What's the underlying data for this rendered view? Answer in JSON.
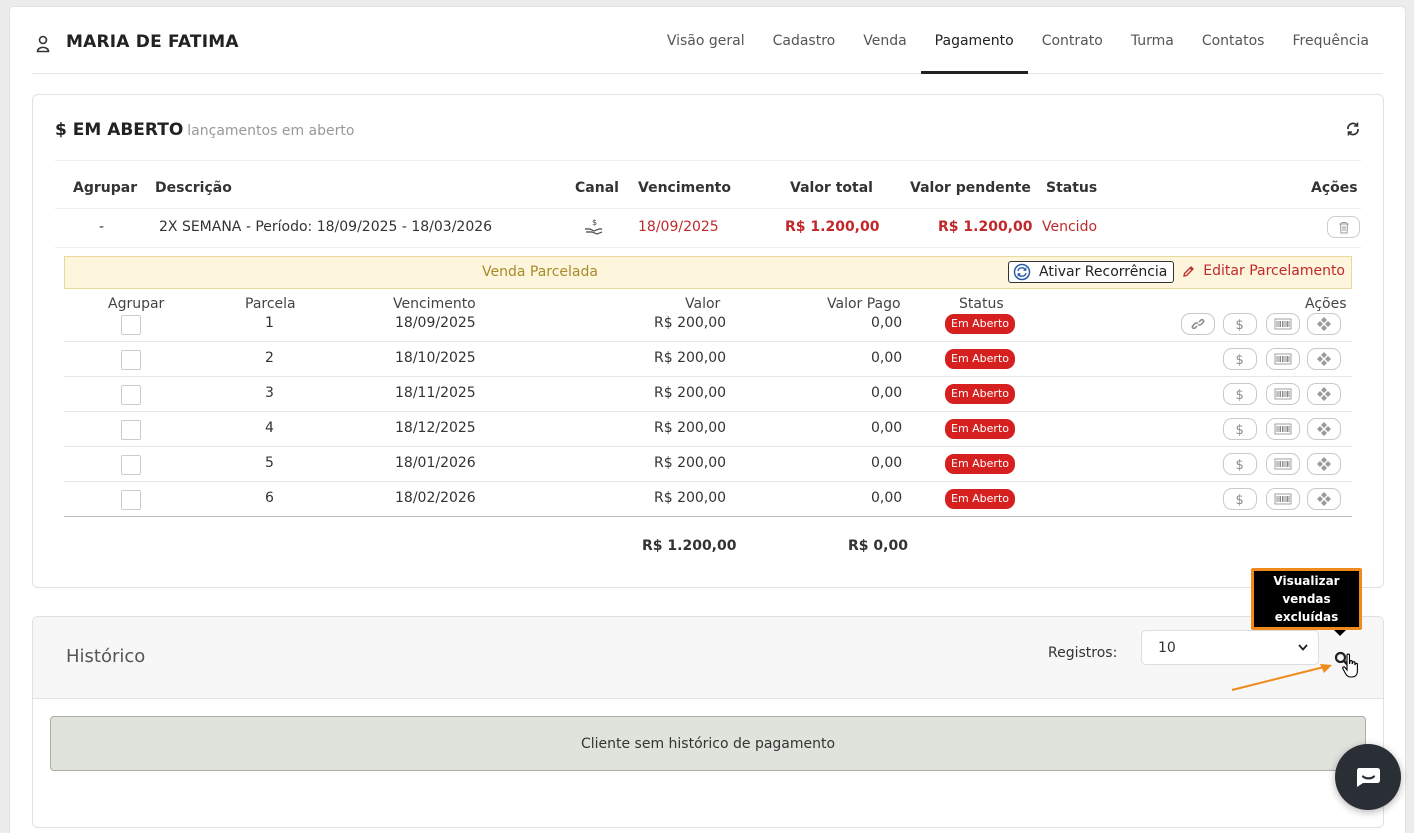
{
  "client": {
    "name": "MARIA DE FATIMA"
  },
  "tabs": [
    {
      "label": "Visão geral"
    },
    {
      "label": "Cadastro"
    },
    {
      "label": "Venda"
    },
    {
      "label": "Pagamento",
      "active": true
    },
    {
      "label": "Contrato"
    },
    {
      "label": "Turma"
    },
    {
      "label": "Contatos"
    },
    {
      "label": "Frequência"
    }
  ],
  "open": {
    "title": "$ EM ABERTO",
    "subtitle": "lançamentos em aberto",
    "columns": {
      "agrupar": "Agrupar",
      "descricao": "Descrição",
      "canal": "Canal",
      "vencimento": "Vencimento",
      "valor_total": "Valor total",
      "valor_pendente": "Valor pendente",
      "status": "Status",
      "acoes": "Ações"
    },
    "row": {
      "agrupar": "-",
      "descricao": "2X SEMANA - Período: 18/09/2025 - 18/03/2026",
      "canal_icon": "hand-money-icon",
      "vencimento": "18/09/2025",
      "valor_total": "R$ 1.200,00",
      "valor_pendente": "R$ 1.200,00",
      "status": "Vencido"
    },
    "banner": {
      "title": "Venda Parcelada",
      "recurrence_label": "Ativar Recorrência",
      "edit_label": "Editar Parcelamento"
    },
    "installments": {
      "columns": {
        "agrupar": "Agrupar",
        "parcela": "Parcela",
        "vencimento": "Vencimento",
        "valor": "Valor",
        "valor_pago": "Valor Pago",
        "status": "Status",
        "acoes": "Ações"
      },
      "rows": [
        {
          "parcela": "1",
          "vencimento": "18/09/2025",
          "valor": "R$ 200,00",
          "valor_pago": "0,00",
          "status": "Em Aberto"
        },
        {
          "parcela": "2",
          "vencimento": "18/10/2025",
          "valor": "R$ 200,00",
          "valor_pago": "0,00",
          "status": "Em Aberto"
        },
        {
          "parcela": "3",
          "vencimento": "18/11/2025",
          "valor": "R$ 200,00",
          "valor_pago": "0,00",
          "status": "Em Aberto"
        },
        {
          "parcela": "4",
          "vencimento": "18/12/2025",
          "valor": "R$ 200,00",
          "valor_pago": "0,00",
          "status": "Em Aberto"
        },
        {
          "parcela": "5",
          "vencimento": "18/01/2026",
          "valor": "R$ 200,00",
          "valor_pago": "0,00",
          "status": "Em Aberto"
        },
        {
          "parcela": "6",
          "vencimento": "18/02/2026",
          "valor": "R$ 200,00",
          "valor_pago": "0,00",
          "status": "Em Aberto"
        }
      ],
      "totals": {
        "valor": "R$ 1.200,00",
        "valor_pago": "R$ 0,00"
      }
    }
  },
  "history": {
    "title": "Histórico",
    "registros_label": "Registros:",
    "registros_value": "10",
    "empty_message": "Cliente sem histórico de pagamento"
  },
  "tooltip": {
    "text": "Visualizar vendas excluídas"
  },
  "colors": {
    "accent_red": "#c0282b",
    "badge_red": "#d62020",
    "banner_bg": "#fdf6dc",
    "tooltip_border": "#f08a1c"
  }
}
